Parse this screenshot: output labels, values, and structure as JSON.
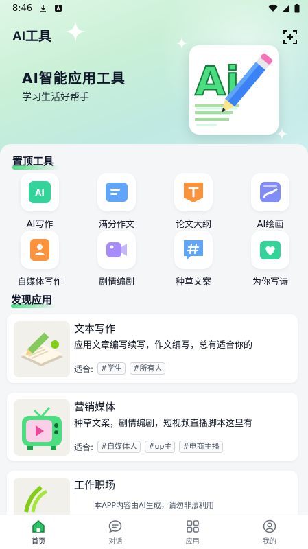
{
  "status_bar": {
    "time": "8:46"
  },
  "header": {
    "title": "AI工具"
  },
  "hero": {
    "heading": "AI智能应用工具",
    "subtitle": "学习生活好帮手",
    "art_text": "Ai"
  },
  "pinned": {
    "title": "置顶工具",
    "tools": [
      {
        "label": "AI写作",
        "icon": "ai-text-icon",
        "color": "#34d399"
      },
      {
        "label": "满分作文",
        "icon": "book-icon",
        "color": "#60a5fa"
      },
      {
        "label": "论文大纲",
        "icon": "outline-icon",
        "color": "#fb923c"
      },
      {
        "label": "AI绘画",
        "icon": "paint-icon",
        "color": "#818cf8"
      },
      {
        "label": "自媒体写作",
        "icon": "person-doc-icon",
        "color": "#fb923c"
      },
      {
        "label": "剧情编剧",
        "icon": "video-icon",
        "color": "#a78bfa"
      },
      {
        "label": "种草文案",
        "icon": "hashtag-icon",
        "color": "#60a5fa"
      },
      {
        "label": "为你写诗",
        "icon": "heart-icon",
        "color": "#34d399"
      }
    ]
  },
  "discover": {
    "title": "发现应用",
    "suit_label": "适合:",
    "apps": [
      {
        "title": "文本写作",
        "desc": "应用文章编写续写，作文编写，总有适合你的",
        "tags": [
          "#学生",
          "#所有人"
        ]
      },
      {
        "title": "营销媒体",
        "desc": "种草文案，剧情编剧，短视频直播脚本这里有",
        "tags": [
          "#自媒体人",
          "#up主",
          "#电商主播"
        ]
      },
      {
        "title": "工作职场",
        "desc": "",
        "tags": []
      }
    ]
  },
  "notice": "本APP内容由AI生成，请勿非法利用",
  "nav": {
    "items": [
      {
        "label": "首页",
        "icon": "home-icon"
      },
      {
        "label": "对话",
        "icon": "chat-icon"
      },
      {
        "label": "应用",
        "icon": "apps-icon"
      },
      {
        "label": "我的",
        "icon": "profile-icon"
      }
    ],
    "active": "首页",
    "active_color": "#22c55e"
  }
}
